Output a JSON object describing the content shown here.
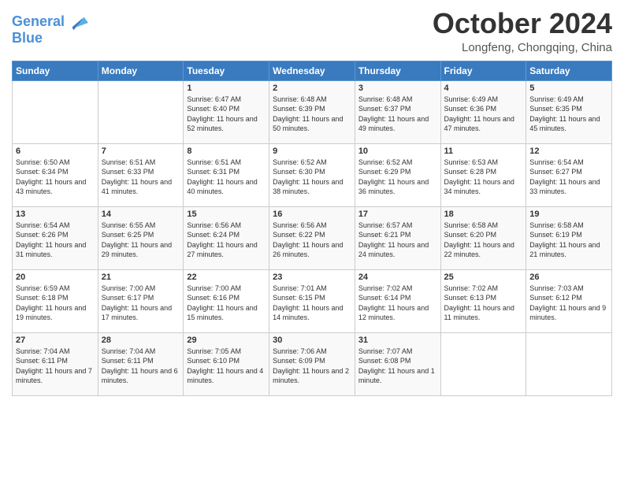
{
  "header": {
    "logo_line1": "General",
    "logo_line2": "Blue",
    "month": "October 2024",
    "location": "Longfeng, Chongqing, China"
  },
  "days_of_week": [
    "Sunday",
    "Monday",
    "Tuesday",
    "Wednesday",
    "Thursday",
    "Friday",
    "Saturday"
  ],
  "weeks": [
    [
      {
        "day": "",
        "sunrise": "",
        "sunset": "",
        "daylight": ""
      },
      {
        "day": "",
        "sunrise": "",
        "sunset": "",
        "daylight": ""
      },
      {
        "day": "1",
        "sunrise": "Sunrise: 6:47 AM",
        "sunset": "Sunset: 6:40 PM",
        "daylight": "Daylight: 11 hours and 52 minutes."
      },
      {
        "day": "2",
        "sunrise": "Sunrise: 6:48 AM",
        "sunset": "Sunset: 6:39 PM",
        "daylight": "Daylight: 11 hours and 50 minutes."
      },
      {
        "day": "3",
        "sunrise": "Sunrise: 6:48 AM",
        "sunset": "Sunset: 6:37 PM",
        "daylight": "Daylight: 11 hours and 49 minutes."
      },
      {
        "day": "4",
        "sunrise": "Sunrise: 6:49 AM",
        "sunset": "Sunset: 6:36 PM",
        "daylight": "Daylight: 11 hours and 47 minutes."
      },
      {
        "day": "5",
        "sunrise": "Sunrise: 6:49 AM",
        "sunset": "Sunset: 6:35 PM",
        "daylight": "Daylight: 11 hours and 45 minutes."
      }
    ],
    [
      {
        "day": "6",
        "sunrise": "Sunrise: 6:50 AM",
        "sunset": "Sunset: 6:34 PM",
        "daylight": "Daylight: 11 hours and 43 minutes."
      },
      {
        "day": "7",
        "sunrise": "Sunrise: 6:51 AM",
        "sunset": "Sunset: 6:33 PM",
        "daylight": "Daylight: 11 hours and 41 minutes."
      },
      {
        "day": "8",
        "sunrise": "Sunrise: 6:51 AM",
        "sunset": "Sunset: 6:31 PM",
        "daylight": "Daylight: 11 hours and 40 minutes."
      },
      {
        "day": "9",
        "sunrise": "Sunrise: 6:52 AM",
        "sunset": "Sunset: 6:30 PM",
        "daylight": "Daylight: 11 hours and 38 minutes."
      },
      {
        "day": "10",
        "sunrise": "Sunrise: 6:52 AM",
        "sunset": "Sunset: 6:29 PM",
        "daylight": "Daylight: 11 hours and 36 minutes."
      },
      {
        "day": "11",
        "sunrise": "Sunrise: 6:53 AM",
        "sunset": "Sunset: 6:28 PM",
        "daylight": "Daylight: 11 hours and 34 minutes."
      },
      {
        "day": "12",
        "sunrise": "Sunrise: 6:54 AM",
        "sunset": "Sunset: 6:27 PM",
        "daylight": "Daylight: 11 hours and 33 minutes."
      }
    ],
    [
      {
        "day": "13",
        "sunrise": "Sunrise: 6:54 AM",
        "sunset": "Sunset: 6:26 PM",
        "daylight": "Daylight: 11 hours and 31 minutes."
      },
      {
        "day": "14",
        "sunrise": "Sunrise: 6:55 AM",
        "sunset": "Sunset: 6:25 PM",
        "daylight": "Daylight: 11 hours and 29 minutes."
      },
      {
        "day": "15",
        "sunrise": "Sunrise: 6:56 AM",
        "sunset": "Sunset: 6:24 PM",
        "daylight": "Daylight: 11 hours and 27 minutes."
      },
      {
        "day": "16",
        "sunrise": "Sunrise: 6:56 AM",
        "sunset": "Sunset: 6:22 PM",
        "daylight": "Daylight: 11 hours and 26 minutes."
      },
      {
        "day": "17",
        "sunrise": "Sunrise: 6:57 AM",
        "sunset": "Sunset: 6:21 PM",
        "daylight": "Daylight: 11 hours and 24 minutes."
      },
      {
        "day": "18",
        "sunrise": "Sunrise: 6:58 AM",
        "sunset": "Sunset: 6:20 PM",
        "daylight": "Daylight: 11 hours and 22 minutes."
      },
      {
        "day": "19",
        "sunrise": "Sunrise: 6:58 AM",
        "sunset": "Sunset: 6:19 PM",
        "daylight": "Daylight: 11 hours and 21 minutes."
      }
    ],
    [
      {
        "day": "20",
        "sunrise": "Sunrise: 6:59 AM",
        "sunset": "Sunset: 6:18 PM",
        "daylight": "Daylight: 11 hours and 19 minutes."
      },
      {
        "day": "21",
        "sunrise": "Sunrise: 7:00 AM",
        "sunset": "Sunset: 6:17 PM",
        "daylight": "Daylight: 11 hours and 17 minutes."
      },
      {
        "day": "22",
        "sunrise": "Sunrise: 7:00 AM",
        "sunset": "Sunset: 6:16 PM",
        "daylight": "Daylight: 11 hours and 15 minutes."
      },
      {
        "day": "23",
        "sunrise": "Sunrise: 7:01 AM",
        "sunset": "Sunset: 6:15 PM",
        "daylight": "Daylight: 11 hours and 14 minutes."
      },
      {
        "day": "24",
        "sunrise": "Sunrise: 7:02 AM",
        "sunset": "Sunset: 6:14 PM",
        "daylight": "Daylight: 11 hours and 12 minutes."
      },
      {
        "day": "25",
        "sunrise": "Sunrise: 7:02 AM",
        "sunset": "Sunset: 6:13 PM",
        "daylight": "Daylight: 11 hours and 11 minutes."
      },
      {
        "day": "26",
        "sunrise": "Sunrise: 7:03 AM",
        "sunset": "Sunset: 6:12 PM",
        "daylight": "Daylight: 11 hours and 9 minutes."
      }
    ],
    [
      {
        "day": "27",
        "sunrise": "Sunrise: 7:04 AM",
        "sunset": "Sunset: 6:11 PM",
        "daylight": "Daylight: 11 hours and 7 minutes."
      },
      {
        "day": "28",
        "sunrise": "Sunrise: 7:04 AM",
        "sunset": "Sunset: 6:11 PM",
        "daylight": "Daylight: 11 hours and 6 minutes."
      },
      {
        "day": "29",
        "sunrise": "Sunrise: 7:05 AM",
        "sunset": "Sunset: 6:10 PM",
        "daylight": "Daylight: 11 hours and 4 minutes."
      },
      {
        "day": "30",
        "sunrise": "Sunrise: 7:06 AM",
        "sunset": "Sunset: 6:09 PM",
        "daylight": "Daylight: 11 hours and 2 minutes."
      },
      {
        "day": "31",
        "sunrise": "Sunrise: 7:07 AM",
        "sunset": "Sunset: 6:08 PM",
        "daylight": "Daylight: 11 hours and 1 minute."
      },
      {
        "day": "",
        "sunrise": "",
        "sunset": "",
        "daylight": ""
      },
      {
        "day": "",
        "sunrise": "",
        "sunset": "",
        "daylight": ""
      }
    ]
  ]
}
